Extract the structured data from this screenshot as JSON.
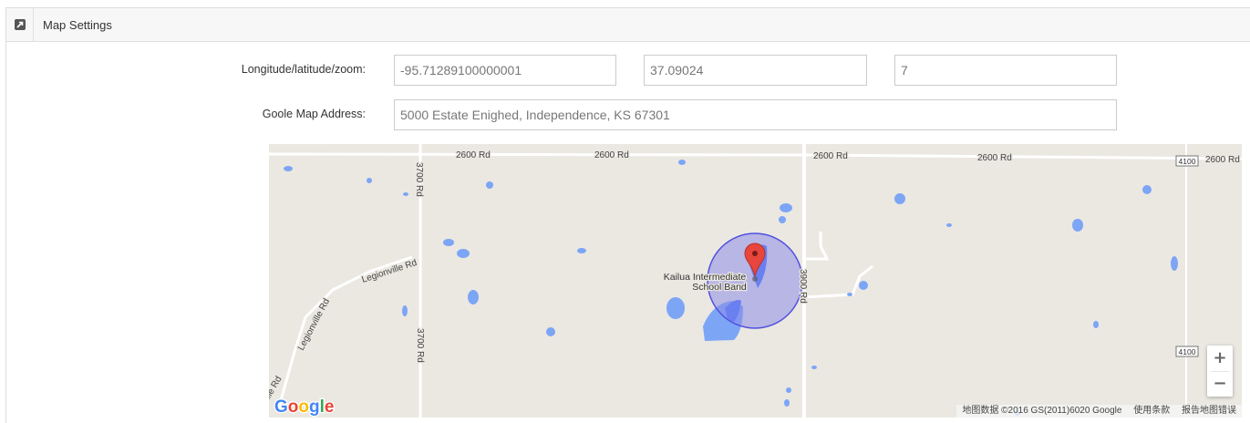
{
  "panel": {
    "title": "Map Settings",
    "icon": "external-link-icon"
  },
  "form": {
    "coords_label": "Longitude/latitude/zoom:",
    "longitude": "-95.71289100000001",
    "latitude": "37.09024",
    "zoom": "7",
    "address_label": "Goole Map Address:",
    "address": "5000 Estate Enighed, Independence, KS 67301"
  },
  "map": {
    "road_labels": {
      "rd2600_a": "2600 Rd",
      "rd2600_b": "2600 Rd",
      "rd2600_c": "2600 Rd",
      "rd2600_d": "2600 Rd",
      "rd2600_e": "2600 Rd",
      "rd3700_top": "3700 Rd",
      "rd3700_bottom": "3700 Rd",
      "rd3900": "3900 Rd",
      "legionville_1": "Legionville Rd",
      "legionville_2": "Legionville Rd",
      "ille": "ille Rd",
      "shield_top": "4100",
      "shield_bottom": "4100"
    },
    "place_name_line1": "Kailua Intermediate",
    "place_name_line2": "School Band",
    "logo": "Google",
    "zoom_in": "+",
    "zoom_out": "−",
    "attribution": "地图数据 ©2016 GS(2011)6020 Google",
    "terms": "使用条款",
    "report": "报告地图错误",
    "colors": {
      "land": "#ebe8e2",
      "water": "#7ca5f5",
      "road": "#ffffff",
      "circle_fill": "#8c8ce6",
      "circle_stroke": "#5050e0",
      "marker": "#e8453c"
    }
  }
}
